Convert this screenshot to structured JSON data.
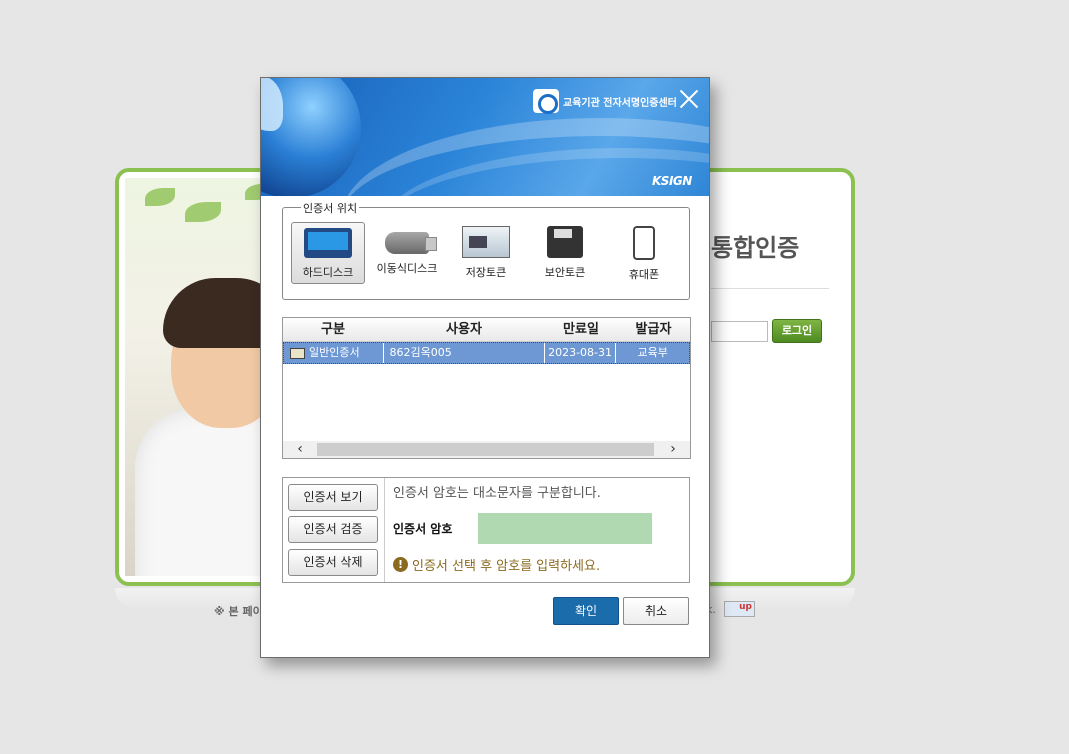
{
  "background": {
    "title": "통합인증",
    "login_label": "로그인",
    "footer_left": "※ 본 페이",
    "footer_right": "k.",
    "badge": "up"
  },
  "dialog": {
    "brand": "교육기관 전자서명인증센터",
    "vendor": "KSIGN",
    "location": {
      "legend": "인증서 위치",
      "items": [
        {
          "label": "하드디스크",
          "icon": "hard-disk-icon",
          "selected": true
        },
        {
          "label": "이동식디스크",
          "icon": "usb-drive-icon",
          "selected": false
        },
        {
          "label": "저장토큰",
          "icon": "storage-token-icon",
          "selected": false
        },
        {
          "label": "보안토큰",
          "icon": "security-token-icon",
          "selected": false
        },
        {
          "label": "휴대폰",
          "icon": "mobile-phone-icon",
          "selected": false
        }
      ]
    },
    "table": {
      "headers": [
        "구분",
        "사용자",
        "만료일",
        "발급자"
      ],
      "rows": [
        {
          "type": "일반인증서",
          "user": "862김옥005",
          "expiry": "2023-08-31",
          "issuer": "교육부"
        }
      ]
    },
    "buttons": {
      "view": "인증서 보기",
      "verify": "인증서 검증",
      "delete": "인증서 삭제",
      "ok": "확인",
      "cancel": "취소"
    },
    "password": {
      "notice": "인증서 암호는 대소문자를 구분합니다.",
      "label": "인증서 암호",
      "value": "",
      "warning": "인증서 선택 후 암호를 입력하세요."
    }
  },
  "colors": {
    "accent": "#1a6cab",
    "selected_row": "#6e98d4",
    "password_bg": "#b0d8b1",
    "frame_green": "#8cc152"
  }
}
